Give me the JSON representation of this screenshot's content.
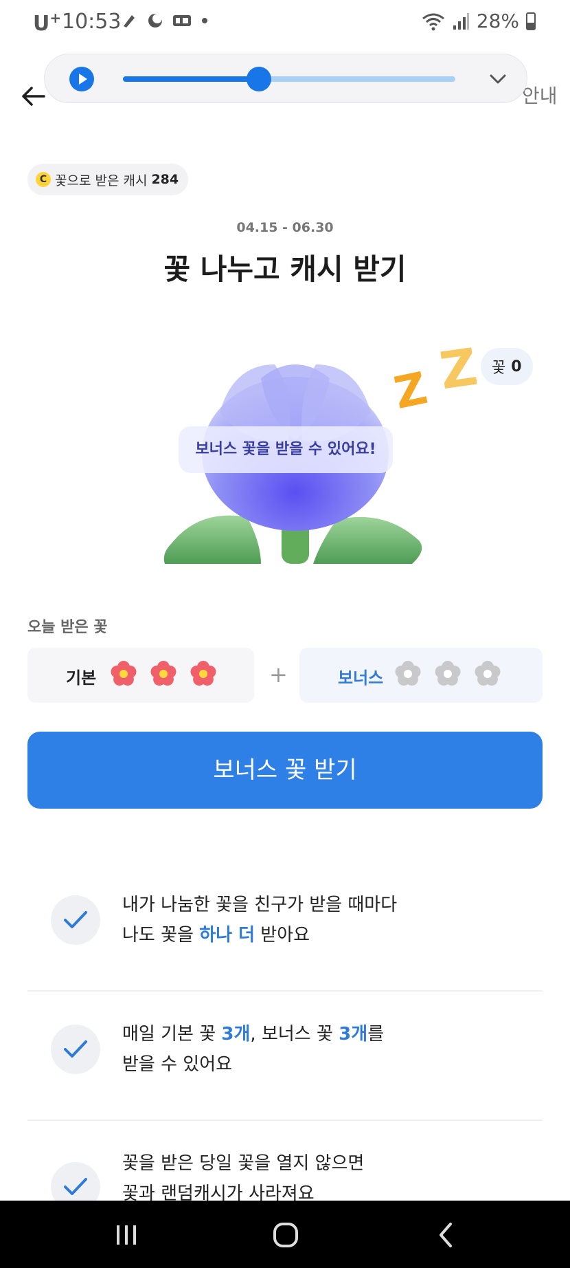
{
  "status_bar": {
    "carrier": "U",
    "carrier_sup": "+",
    "time": "10:53",
    "battery": "28%"
  },
  "header": {
    "guide": "안내"
  },
  "player": {
    "progress": 0.41
  },
  "cash": {
    "coin": "C",
    "label": "꽃으로 받은 캐시",
    "value": "284"
  },
  "event": {
    "period": "04.15 - 06.30",
    "title": "꽃 나누고 캐시 받기"
  },
  "flower_state": {
    "count_label": "꽃",
    "count_value": "0",
    "bubble": "보너스 꽃을 받을 수 있어요!"
  },
  "today": {
    "label": "오늘 받은 꽃",
    "basic_label": "기본",
    "basic_filled": 3,
    "plus": "+",
    "bonus_label": "보너스",
    "bonus_filled": 0
  },
  "cta": {
    "label": "보너스 꽃 받기"
  },
  "info": [
    {
      "line1": "내가 나눔한 꽃을 친구가 받을 때마다",
      "line2_a": "나도 꽃을 ",
      "line2_hl": "하나 더",
      "line2_b": " 받아요"
    },
    {
      "line1_a": "매일 기본 꽃 ",
      "line1_hl1": "3개",
      "line1_b": ", 보너스 꽃 ",
      "line1_hl2": "3개",
      "line1_c": "를",
      "line2": "받을 수 있어요"
    },
    {
      "line1": "꽃을 받은 당일 꽃을 열지 않으면",
      "line2": "꽃과 랜덤캐시가 사라져요"
    }
  ],
  "colors": {
    "accent": "#2f80e6",
    "highlight": "#2f7bd6",
    "flower_basic": "#f0606a",
    "flower_empty": "#c9c9cc",
    "flower_petal": "#7a7cf2"
  }
}
